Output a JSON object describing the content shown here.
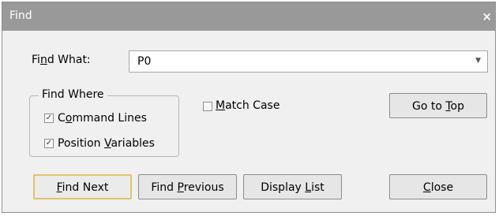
{
  "window": {
    "title": "Find",
    "close_label": "×"
  },
  "find_what": {
    "label_pre": "Fi",
    "label_key": "n",
    "label_post": "d What:",
    "value": "P0",
    "arrow": "▼"
  },
  "find_where": {
    "legend": "Find Where",
    "command_lines": {
      "checked": true,
      "pre": "C",
      "key": "o",
      "post": "mmand Lines"
    },
    "position_variables": {
      "checked": true,
      "pre": "Position ",
      "key": "V",
      "post": "ariables"
    }
  },
  "match_case": {
    "checked": false,
    "pre": "",
    "key": "M",
    "post": "atch Case"
  },
  "buttons": {
    "go_to_top": {
      "pre": "Go to ",
      "key": "T",
      "post": "op"
    },
    "find_next": {
      "pre": "",
      "key": "F",
      "post": "ind Next"
    },
    "find_previous": {
      "pre": "Find ",
      "key": "P",
      "post": "revious"
    },
    "display_list": {
      "pre": "Display ",
      "key": "L",
      "post": "ist"
    },
    "close": {
      "pre": "",
      "key": "C",
      "post": "lose"
    }
  },
  "checkmark": "✓"
}
